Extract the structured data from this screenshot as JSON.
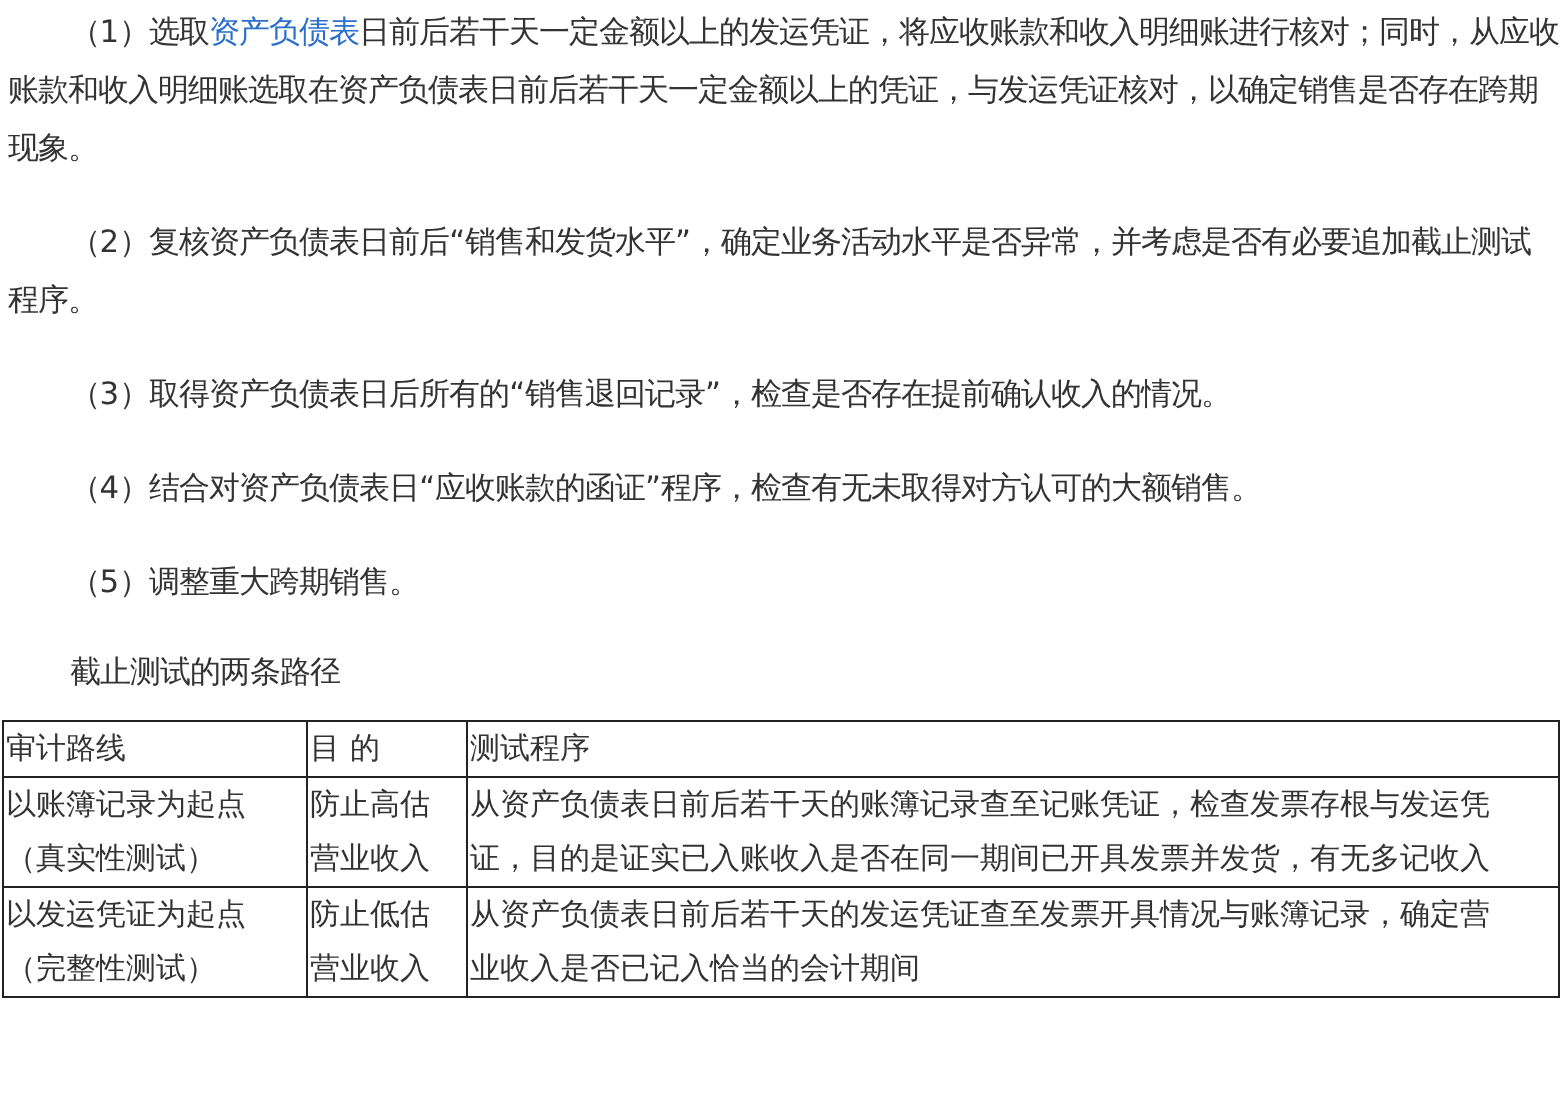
{
  "paragraphs": [
    {
      "before": "（1）选取",
      "link": "资产负债表",
      "after": "日前后若干天一定金额以上的发运凭证，将应收账款和收入明细账进行核对；同时，从应收账款和收入明细账选取在资产负债表日前后若干天一定金额以上的凭证，与发运凭证核对，以确定销售是否存在跨期现象。"
    },
    {
      "before": "（2）复核资产负债表日前后“销售和发货水平”，确定业务活动水平是否异常，并考虑是否有必要追加截止测试程序。"
    },
    {
      "before": "（3）取得资产负债表日后所有的“销售退回记录”，检查是否存在提前确认收入的情况。"
    },
    {
      "before": "（4）结合对资产负债表日“应收账款的函证”程序，检查有无未取得对方认可的大额销售。"
    },
    {
      "before": "（5）调整重大跨期销售。"
    }
  ],
  "table_caption": "截止测试的两条路径",
  "table": {
    "columns": [
      "审计路线",
      "目 的",
      "测试程序"
    ],
    "rows": [
      [
        [
          "以账簿记录为起点",
          "（真实性测试）"
        ],
        [
          "防止高估",
          "营业收入"
        ],
        [
          "从资产负债表日前后若干天的账簿记录查至记账凭证，检查发票存根与发运凭",
          "证，目的是证实已入账收入是否在同一期间已开具发票并发货，有无多记收入"
        ]
      ],
      [
        [
          "以发运凭证为起点",
          "（完整性测试）"
        ],
        [
          "防止低估",
          "营业收入"
        ],
        [
          "从资产负债表日前后若干天的发运凭证查至发票开具情况与账簿记录，确定营",
          "业收入是否已记入恰当的会计期间"
        ]
      ]
    ]
  }
}
